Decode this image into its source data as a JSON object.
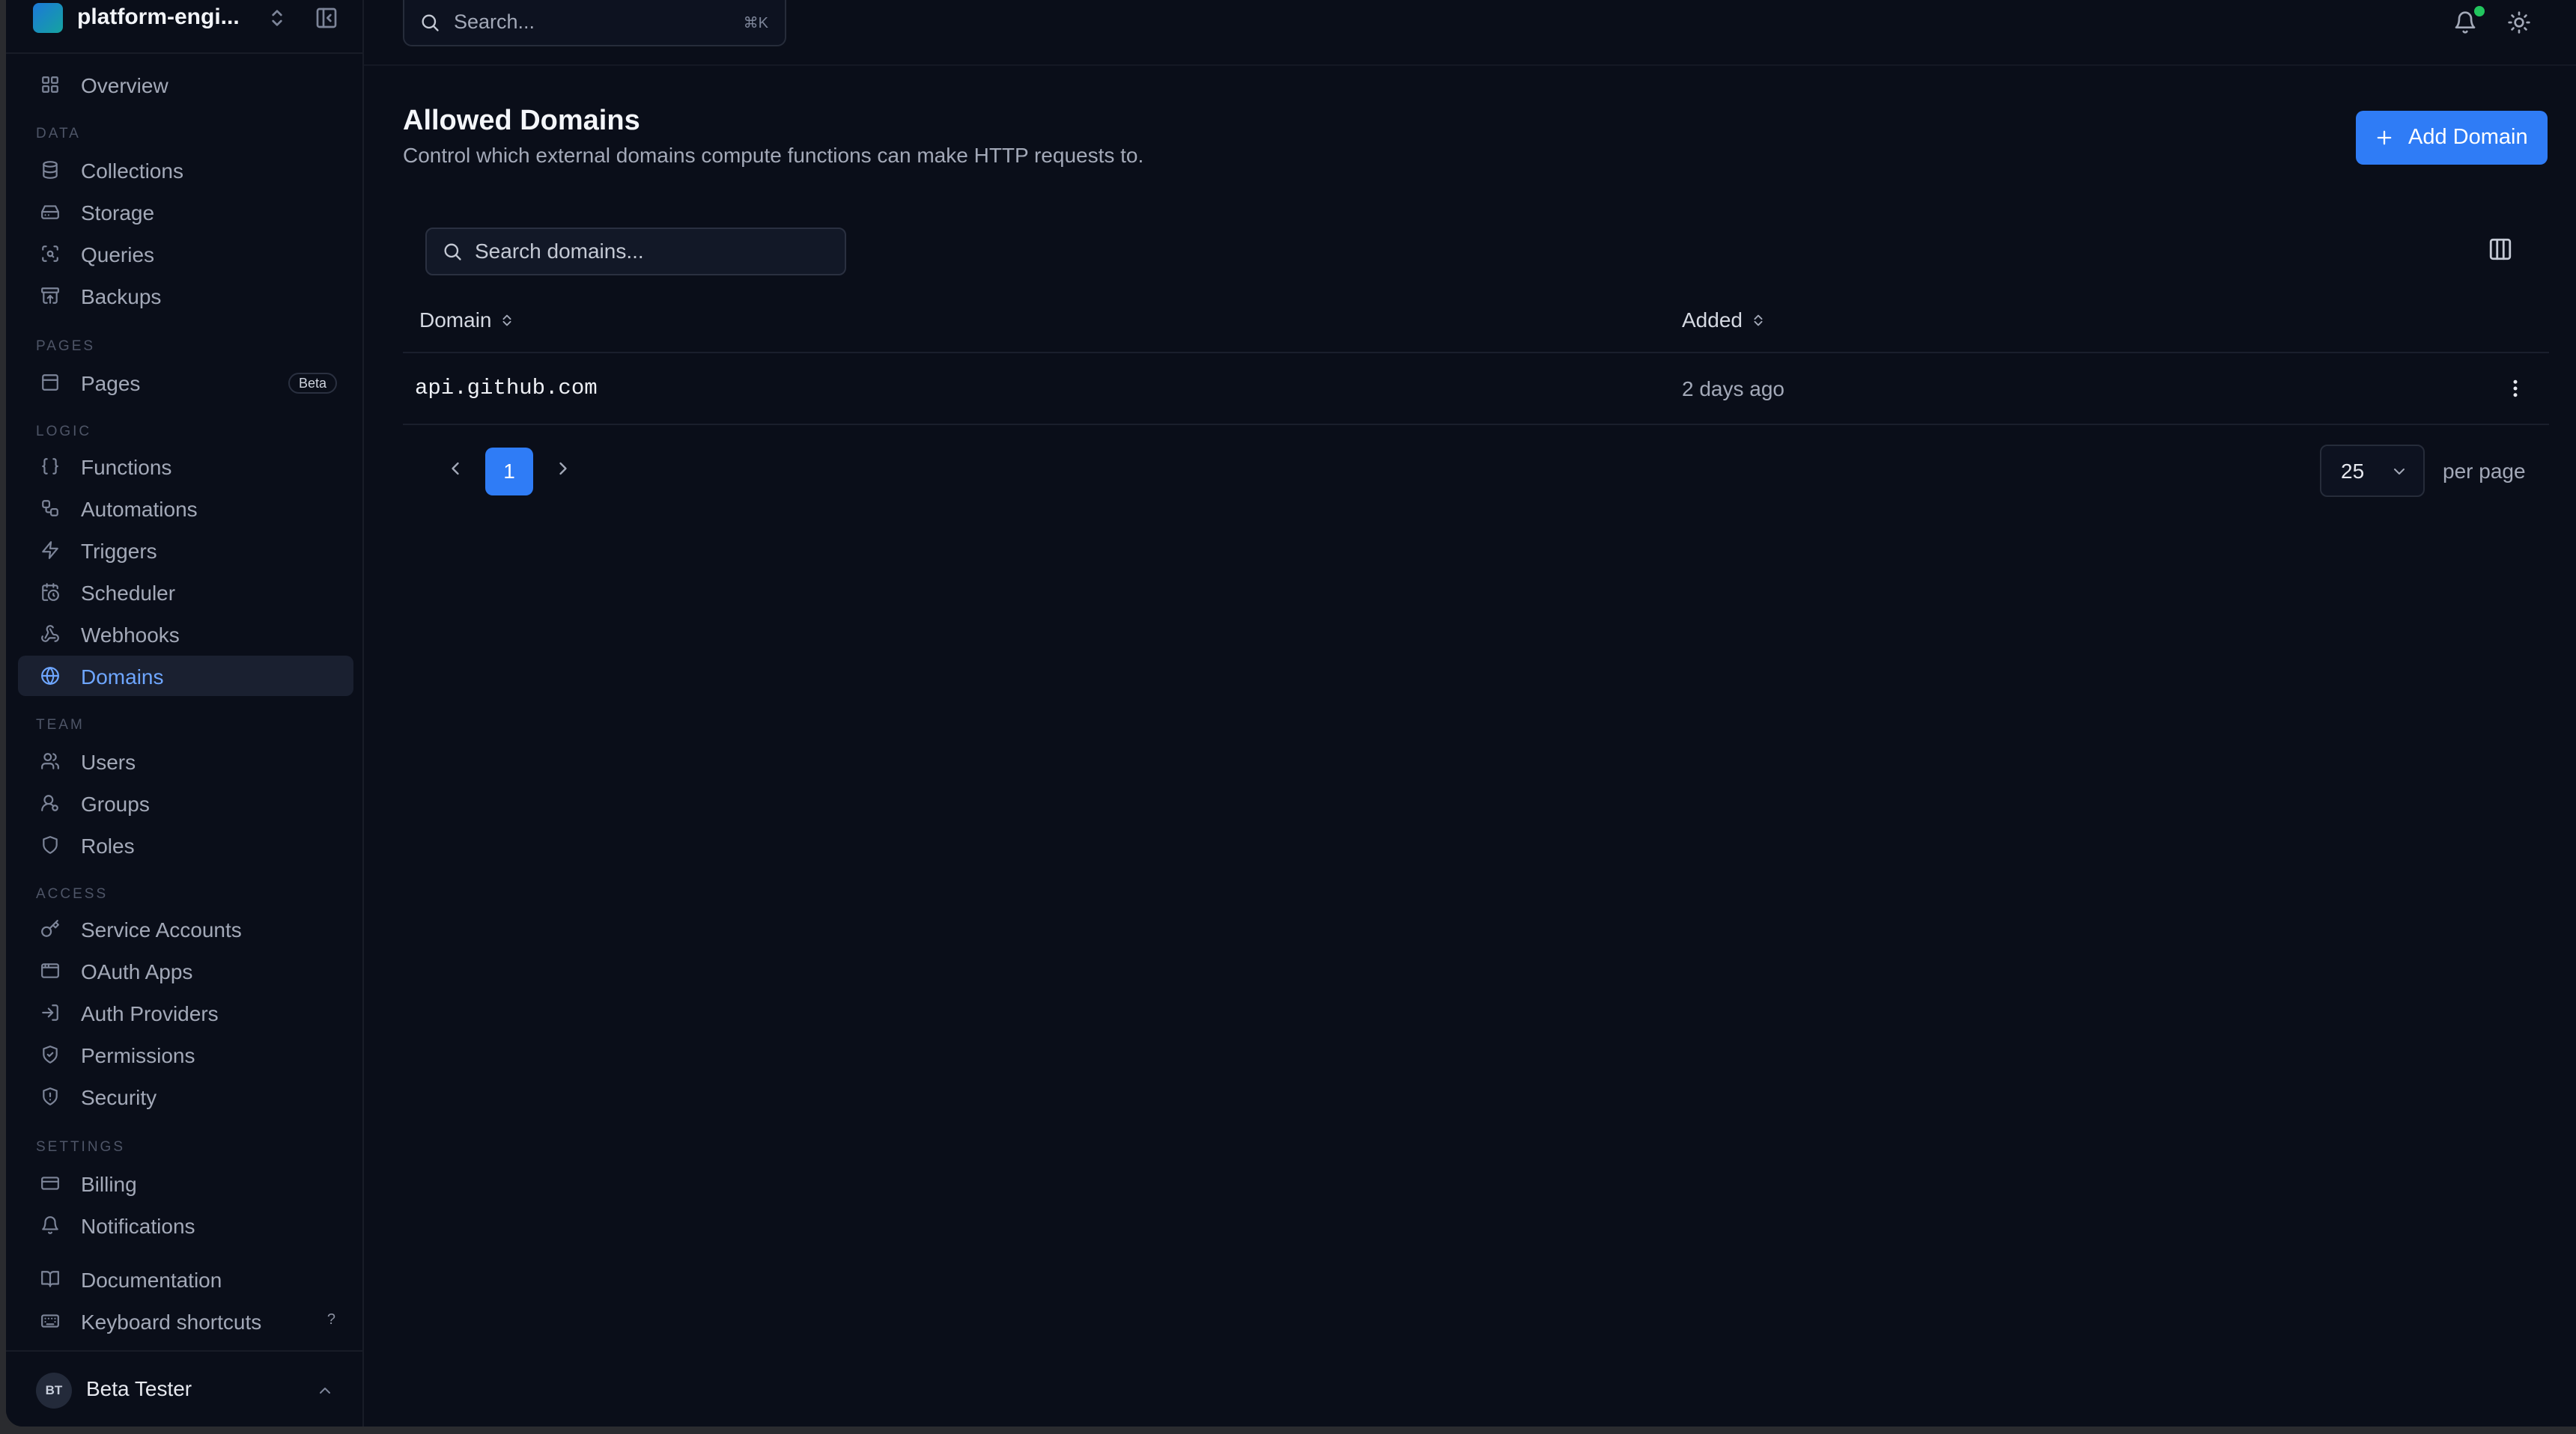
{
  "workspace": {
    "name": "platform-engi..."
  },
  "search": {
    "label": "Search...",
    "shortcut": "⌘K"
  },
  "sidebar": {
    "overview": "Overview",
    "sections": {
      "data": "DATA",
      "pages": "PAGES",
      "logic": "LOGIC",
      "team": "TEAM",
      "access": "ACCESS",
      "settings": "SETTINGS"
    },
    "items": {
      "collections": "Collections",
      "storage": "Storage",
      "queries": "Queries",
      "backups": "Backups",
      "pages": "Pages",
      "pages_badge": "Beta",
      "functions": "Functions",
      "automations": "Automations",
      "triggers": "Triggers",
      "scheduler": "Scheduler",
      "webhooks": "Webhooks",
      "domains": "Domains",
      "users": "Users",
      "groups": "Groups",
      "roles": "Roles",
      "service_accounts": "Service Accounts",
      "oauth_apps": "OAuth Apps",
      "auth_providers": "Auth Providers",
      "permissions": "Permissions",
      "security": "Security",
      "billing": "Billing",
      "notifications": "Notifications",
      "documentation": "Documentation",
      "keyboard_shortcuts": "Keyboard shortcuts",
      "keyboard_shortcuts_key": "?"
    },
    "active": "Domains"
  },
  "user": {
    "initials": "BT",
    "name": "Beta Tester"
  },
  "page": {
    "title": "Allowed Domains",
    "description": "Control which external domains compute functions can make HTTP requests to.",
    "add_button": "Add Domain",
    "search_placeholder": "Search domains..."
  },
  "table": {
    "columns": [
      "Domain",
      "Added"
    ],
    "rows": [
      {
        "domain": "api.github.com",
        "added": "2 days ago"
      }
    ]
  },
  "pagination": {
    "current_page": "1",
    "per_page": "25",
    "per_page_label": "per page"
  },
  "colors": {
    "background": "#0a0e19",
    "accent": "#2f7cf6",
    "active_text": "#6ea6ff",
    "notification_dot": "#22c55e"
  }
}
